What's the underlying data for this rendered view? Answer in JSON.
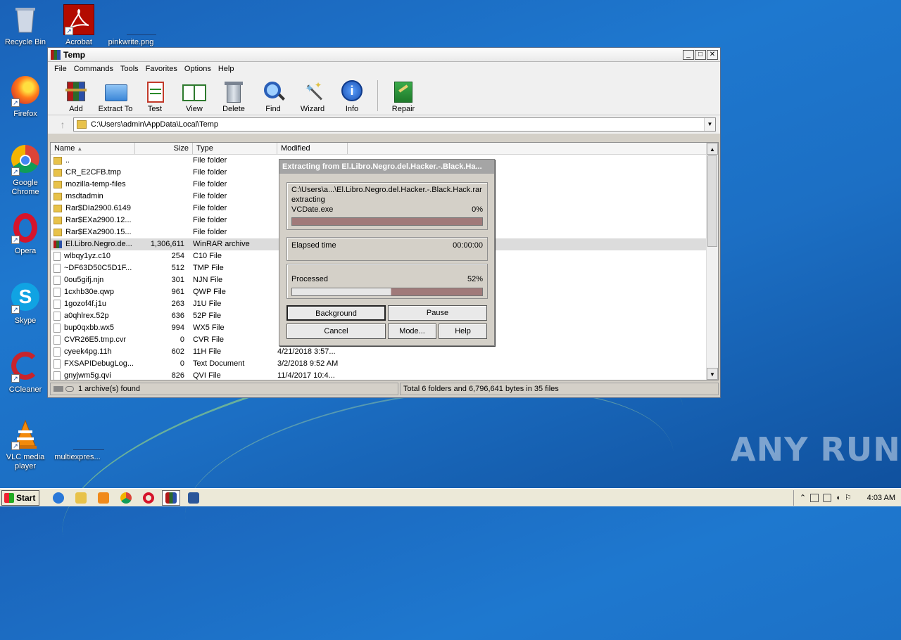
{
  "desktop": {
    "icons": [
      {
        "label": "Recycle Bin",
        "icon": "recycle-bin-icon"
      },
      {
        "label": "Acrobat",
        "icon": "acrobat-icon"
      },
      {
        "label": "pinkwrite.png",
        "icon": "image-file-icon"
      },
      {
        "label": "Firefox",
        "icon": "firefox-icon"
      },
      {
        "label": "Google Chrome",
        "icon": "chrome-icon"
      },
      {
        "label": "Opera",
        "icon": "opera-icon"
      },
      {
        "label": "Skype",
        "icon": "skype-icon"
      },
      {
        "label": "CCleaner",
        "icon": "ccleaner-icon"
      },
      {
        "label": "VLC media player",
        "icon": "vlc-icon"
      },
      {
        "label": "multiexpres...",
        "icon": "file-icon"
      }
    ],
    "watermark": "ANY RUN"
  },
  "window": {
    "title": "Temp",
    "menu": [
      "File",
      "Commands",
      "Tools",
      "Favorites",
      "Options",
      "Help"
    ],
    "toolbar": [
      {
        "label": "Add",
        "icon": "add-archive-icon"
      },
      {
        "label": "Extract To",
        "icon": "extract-folder-icon"
      },
      {
        "label": "Test",
        "icon": "test-clipboard-icon"
      },
      {
        "label": "View",
        "icon": "view-book-icon"
      },
      {
        "label": "Delete",
        "icon": "trash-icon"
      },
      {
        "label": "Find",
        "icon": "magnifier-icon"
      },
      {
        "label": "Wizard",
        "icon": "wand-icon"
      },
      {
        "label": "Info",
        "icon": "info-icon"
      },
      {
        "label": "Repair",
        "icon": "repair-kit-icon"
      }
    ],
    "address": "C:\\Users\\admin\\AppData\\Local\\Temp",
    "columns": {
      "name": "Name",
      "size": "Size",
      "type": "Type",
      "modified": "Modified"
    },
    "files": [
      {
        "name": "..",
        "size": "",
        "type": "File folder",
        "modified": "",
        "kind": "folder"
      },
      {
        "name": "CR_E2CFB.tmp",
        "size": "",
        "type": "File folder",
        "modified": "",
        "kind": "folder"
      },
      {
        "name": "mozilla-temp-files",
        "size": "",
        "type": "File folder",
        "modified": "",
        "kind": "folder"
      },
      {
        "name": "msdtadmin",
        "size": "",
        "type": "File folder",
        "modified": "",
        "kind": "folder"
      },
      {
        "name": "Rar$DIa2900.6149",
        "size": "",
        "type": "File folder",
        "modified": "",
        "kind": "folder"
      },
      {
        "name": "Rar$EXa2900.12...",
        "size": "",
        "type": "File folder",
        "modified": "",
        "kind": "folder"
      },
      {
        "name": "Rar$EXa2900.15...",
        "size": "",
        "type": "File folder",
        "modified": "",
        "kind": "folder"
      },
      {
        "name": "El.Libro.Negro.de...",
        "size": "1,306,611",
        "type": "WinRAR archive",
        "modified": "",
        "kind": "rar"
      },
      {
        "name": "wlbqy1yz.c10",
        "size": "254",
        "type": "C10 File",
        "modified": "",
        "kind": "file"
      },
      {
        "name": "~DF63D50C5D1F...",
        "size": "512",
        "type": "TMP File",
        "modified": "",
        "kind": "file"
      },
      {
        "name": "0ou5gifj.njn",
        "size": "301",
        "type": "NJN File",
        "modified": "",
        "kind": "file"
      },
      {
        "name": "1cxhb30e.qwp",
        "size": "961",
        "type": "QWP File",
        "modified": "",
        "kind": "file"
      },
      {
        "name": "1gozof4f.j1u",
        "size": "263",
        "type": "J1U File",
        "modified": "",
        "kind": "file"
      },
      {
        "name": "a0qhlrex.52p",
        "size": "636",
        "type": "52P File",
        "modified": "",
        "kind": "file"
      },
      {
        "name": "bup0qxbb.wx5",
        "size": "994",
        "type": "WX5 File",
        "modified": "",
        "kind": "file"
      },
      {
        "name": "CVR26E5.tmp.cvr",
        "size": "0",
        "type": "CVR File",
        "modified": "",
        "kind": "file"
      },
      {
        "name": "cyeek4pg.11h",
        "size": "602",
        "type": "11H File",
        "modified": "4/21/2018 3:57...",
        "kind": "file"
      },
      {
        "name": "FXSAPIDebugLog...",
        "size": "0",
        "type": "Text Document",
        "modified": "3/2/2018 9:52 AM",
        "kind": "file"
      },
      {
        "name": "gnyjwm5g.qvi",
        "size": "826",
        "type": "QVI File",
        "modified": "11/4/2017 10:4...",
        "kind": "file"
      }
    ],
    "status_left": "1 archive(s) found",
    "status_right": "Total 6 folders and 6,796,641 bytes in 35 files"
  },
  "dialog": {
    "title": "Extracting from El.Libro.Negro.del.Hacker.-.Black.Ha...",
    "archive_path": "C:\\Users\\a...\\El.Libro.Negro.del.Hacker.-.Black.Hack.rar",
    "action": "extracting",
    "current_file": "VCDate.exe",
    "file_percent": "0%",
    "file_progress": 0,
    "elapsed_label": "Elapsed time",
    "elapsed_value": "00:00:00",
    "processed_label": "Processed",
    "processed_percent": "52%",
    "processed_progress": 0.52,
    "buttons": {
      "background": "Background",
      "pause": "Pause",
      "cancel": "Cancel",
      "mode": "Mode...",
      "help": "Help"
    }
  },
  "taskbar": {
    "start_label": "Start",
    "clock": "4:03 AM"
  }
}
